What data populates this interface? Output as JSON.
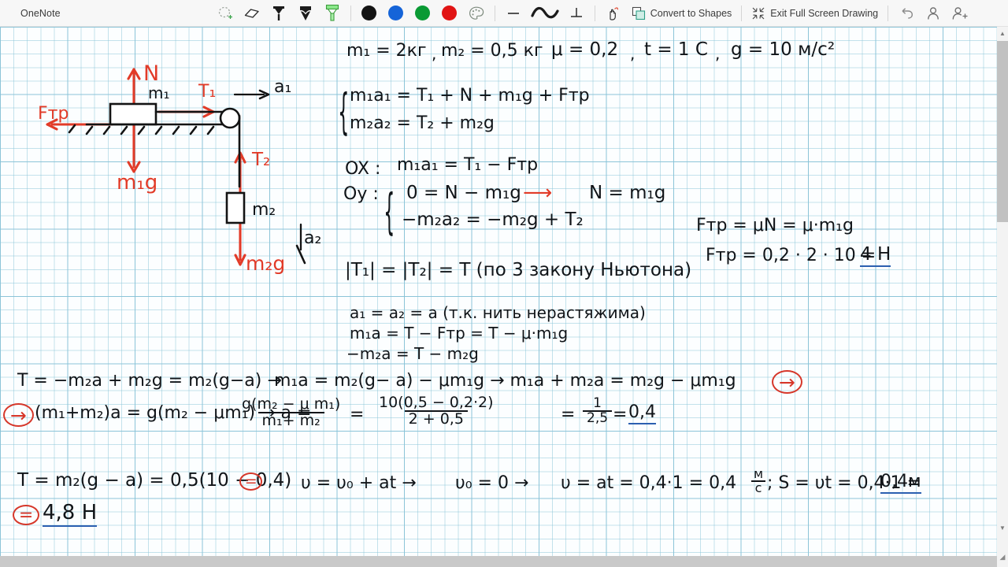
{
  "window": {
    "app_title": "OneNote"
  },
  "toolbar": {
    "tools": [
      {
        "name": "lasso-select-icon",
        "label": "Lasso Select"
      },
      {
        "name": "eraser-icon",
        "label": "Eraser"
      },
      {
        "name": "pen-icon",
        "label": "Pen"
      },
      {
        "name": "pencil-icon",
        "label": "Pencil"
      },
      {
        "name": "highlighter-icon",
        "label": "Highlighter"
      }
    ],
    "colors": [
      {
        "name": "color-black",
        "hex": "#141414"
      },
      {
        "name": "color-blue",
        "hex": "#1564d8"
      },
      {
        "name": "color-green",
        "hex": "#0a9a34"
      },
      {
        "name": "color-red",
        "hex": "#e11414"
      }
    ],
    "palette_icon": "color-palette-icon",
    "shapes": [
      {
        "name": "line-shape-icon",
        "label": "Line"
      },
      {
        "name": "curve-shape-icon",
        "label": "Curve"
      },
      {
        "name": "angle-shape-icon",
        "label": "Perpendicular"
      }
    ],
    "ink_to_text_icon": "ink-gesture-icon",
    "convert_to_shapes_label": "Convert to Shapes",
    "convert_to_shapes_icon": "convert-shapes-icon",
    "exit_full_screen_label": "Exit Full Screen Drawing",
    "exit_full_screen_icon": "exit-fullscreen-icon",
    "undo_icon": "undo-icon",
    "account_icon": "account-icon",
    "add_account_icon": "add-account-icon"
  },
  "scrollbar": {
    "up_arrow": "▲",
    "down_arrow": "▼",
    "resize_grip": "◢"
  },
  "diagram": {
    "labels": {
      "normal_force": "N",
      "mass1": "m₁",
      "tension1": "T₁",
      "accel1": "a₁",
      "friction": "Fтр",
      "weight1": "m₁g",
      "tension2": "T₂",
      "mass2": "m₂",
      "weight2": "m₂g",
      "accel2": "a₂"
    }
  },
  "notes": {
    "givens": {
      "m1": "m₁ = 2кг",
      "m2": "m₂ = 0,5 кг",
      "mu": "μ = 0,2",
      "t": "t = 1 C",
      "g": "g = 10 м/с²"
    },
    "system1": {
      "line1": "m₁a₁ = T₁ + N + m₁g + Fтр",
      "line2": "m₂a₂ = T₂ + m₂g"
    },
    "axes": {
      "ox_label": "OX :",
      "ox_eq": "m₁a₁ = T₁ − Fтр",
      "oy_label": "Oy :",
      "oy_eq1": "0 = N − m₁g",
      "oy_arrow": "⟶",
      "oy_result": "N = m₁g",
      "oy_eq2": "−m₂a₂ = −m₂g + T₂"
    },
    "friction": {
      "formula": "Fтр = μN = μ·m₁g",
      "calc_lhs": "Fтр = 0,2 · 2 · 10 =",
      "calc_result": "4 H"
    },
    "newton3": "|T₁| = |T₂| = T  (по 3 закону Ньютона)",
    "accel_eq": {
      "line1": "a₁ = a₂ = a (т.к. нить нерастяжима)",
      "line2": "m₁a =  T − Fтр  = T − μ·m₁g",
      "line3": "−m₂a = T − m₂g"
    },
    "derivation": {
      "row1_left": "T = −m₂a + m₂g = m₂(g−a)  →",
      "row1_right": "m₁a = m₂(g− a) − μm₁g  →  m₁a + m₂a = m₂g − μm₁g",
      "row1_arrow_circled": "→",
      "row2_arrow_circled": "→",
      "row2_left": "(m₁+m₂)a  =  g(m₂ − μm₁)  →   a =",
      "frac1_num": "g(m₂ − μ m₁)",
      "frac1_den": "m₁+ m₂",
      "eq1": "=",
      "frac2_num": "10(0,5 − 0,2·2)",
      "frac2_den": "2 + 0,5",
      "eq2": "=",
      "frac3_num": "1",
      "frac3_den": "2,5",
      "eq3": "=",
      "a_result": "0,4",
      "row3": "T = m₂(g − a) = 0,5(10 − 0,4)",
      "row3_eq_circled": "=",
      "row4_eq_circled": "=",
      "row4_result": "4,8 H"
    },
    "kinematics": {
      "v_formula": "υ = υ₀ + at  →",
      "v0": "υ₀ = 0  →",
      "v_calc": "υ = at = 0,4·1 = 0,4",
      "v_unit_num": "м",
      "v_unit_den": "с",
      "s_calc_lhs": "; S = υt = 0,4·1 =",
      "s_result": "0,4м"
    }
  }
}
